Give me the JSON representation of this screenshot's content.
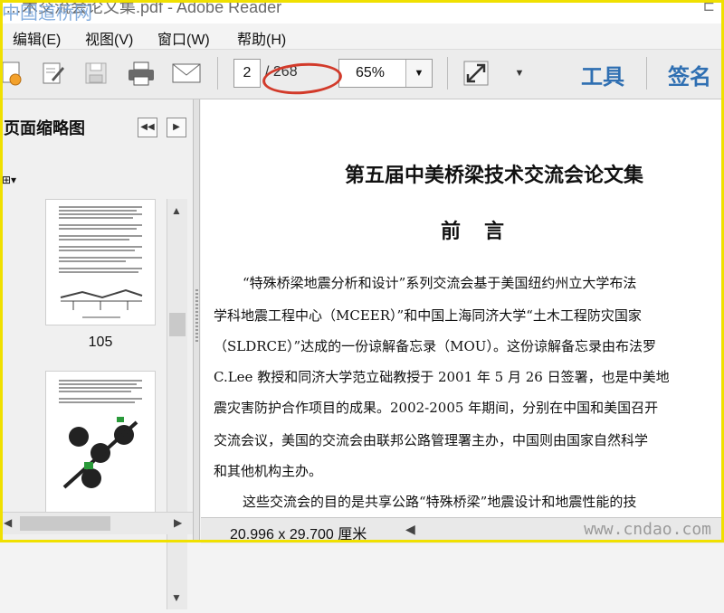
{
  "window": {
    "title": "…术交流会论文集.pdf - Adobe Reader",
    "watermark": "中国道桥网",
    "control": "⊏"
  },
  "menu": [
    "编辑(E)",
    "视图(V)",
    "窗口(W)",
    "帮助(H)"
  ],
  "toolbar": {
    "icons": [
      "create-pdf-icon",
      "sign-edit-icon",
      "save-icon",
      "print-icon",
      "email-icon"
    ],
    "page_current": "2",
    "page_total": "/ 268",
    "zoom": "65%",
    "tools_label": "工具",
    "sign_label": "签名"
  },
  "sidebar": {
    "title": "页面缩略图",
    "options_label": "⊞▾",
    "thumbnails": [
      {
        "page_label": "105"
      },
      {
        "page_label": ""
      }
    ]
  },
  "document": {
    "title": "第五届中美桥梁技术交流会论文集",
    "subtitle": "前言",
    "lines": [
      "“特殊桥梁地震分析和设计”系列交流会基于美国纽约州立大学布法",
      "学科地震工程中心（MCEER）”和中国上海同济大学“土木工程防灾国家",
      "（SLDRCE）”达成的一份谅解备忘录（MOU）。这份谅解备忘录由布法罗",
      "C.Lee 教授和同济大学范立础教授于 2001 年 5 月 26 日签署，也是中美地",
      "震灾害防护合作项目的成果。2002-2005 年期间，分别在中国和美国召开",
      "交流会议，美国的交流会由联邦公路管理署主办，中国则由国家自然科学",
      "和其他机构主办。",
      "这些交流会的目的是共享公路“特殊桥梁”地震设计和地震性能的技"
    ]
  },
  "statusbar": {
    "page_size": "20.996 x 29.700 厘米",
    "watermark": "www.cndao.com"
  },
  "colors": {
    "accent_blue": "#2f6fb2",
    "highlight_red": "#d23a2a",
    "frame_yellow": "#f0e000"
  }
}
